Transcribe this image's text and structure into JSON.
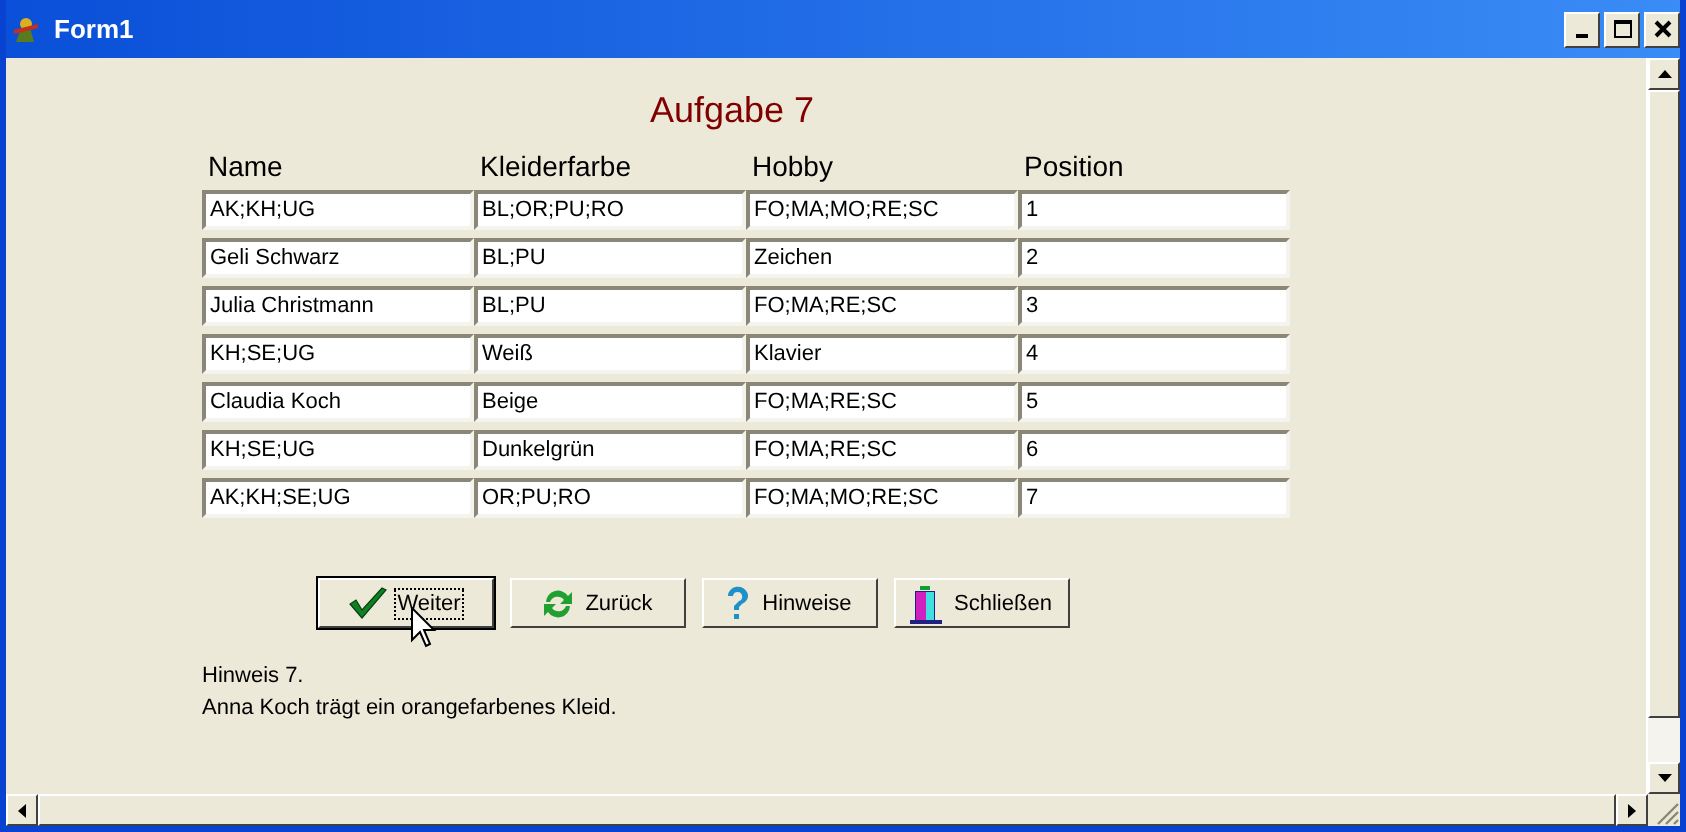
{
  "window": {
    "title": "Form1"
  },
  "heading": "Aufgabe 7",
  "table": {
    "columns": [
      "Name",
      "Kleiderfarbe",
      "Hobby",
      "Position"
    ],
    "rows": [
      [
        "AK;KH;UG",
        "BL;OR;PU;RO",
        "FO;MA;MO;RE;SC",
        "1"
      ],
      [
        "Geli Schwarz",
        "BL;PU",
        "Zeichen",
        "2"
      ],
      [
        "Julia Christmann",
        "BL;PU",
        "FO;MA;RE;SC",
        "3"
      ],
      [
        "KH;SE;UG",
        "Weiß",
        "Klavier",
        "4"
      ],
      [
        "Claudia Koch",
        "Beige",
        "FO;MA;RE;SC",
        "5"
      ],
      [
        "KH;SE;UG",
        "Dunkelgrün",
        "FO;MA;RE;SC",
        "6"
      ],
      [
        "AK;KH;SE;UG",
        "OR;PU;RO",
        "FO;MA;MO;RE;SC",
        "7"
      ]
    ]
  },
  "buttons": [
    {
      "label": "Weiter",
      "kind": "check",
      "focused": true
    },
    {
      "label": "Zurück",
      "kind": "refresh",
      "focused": false
    },
    {
      "label": "Hinweise",
      "kind": "help",
      "focused": false
    },
    {
      "label": "Schließen",
      "kind": "exit",
      "focused": false
    }
  ],
  "hint": [
    "Hinweis 7.",
    "Anna Koch trägt ein orangefarbenes Kleid."
  ]
}
